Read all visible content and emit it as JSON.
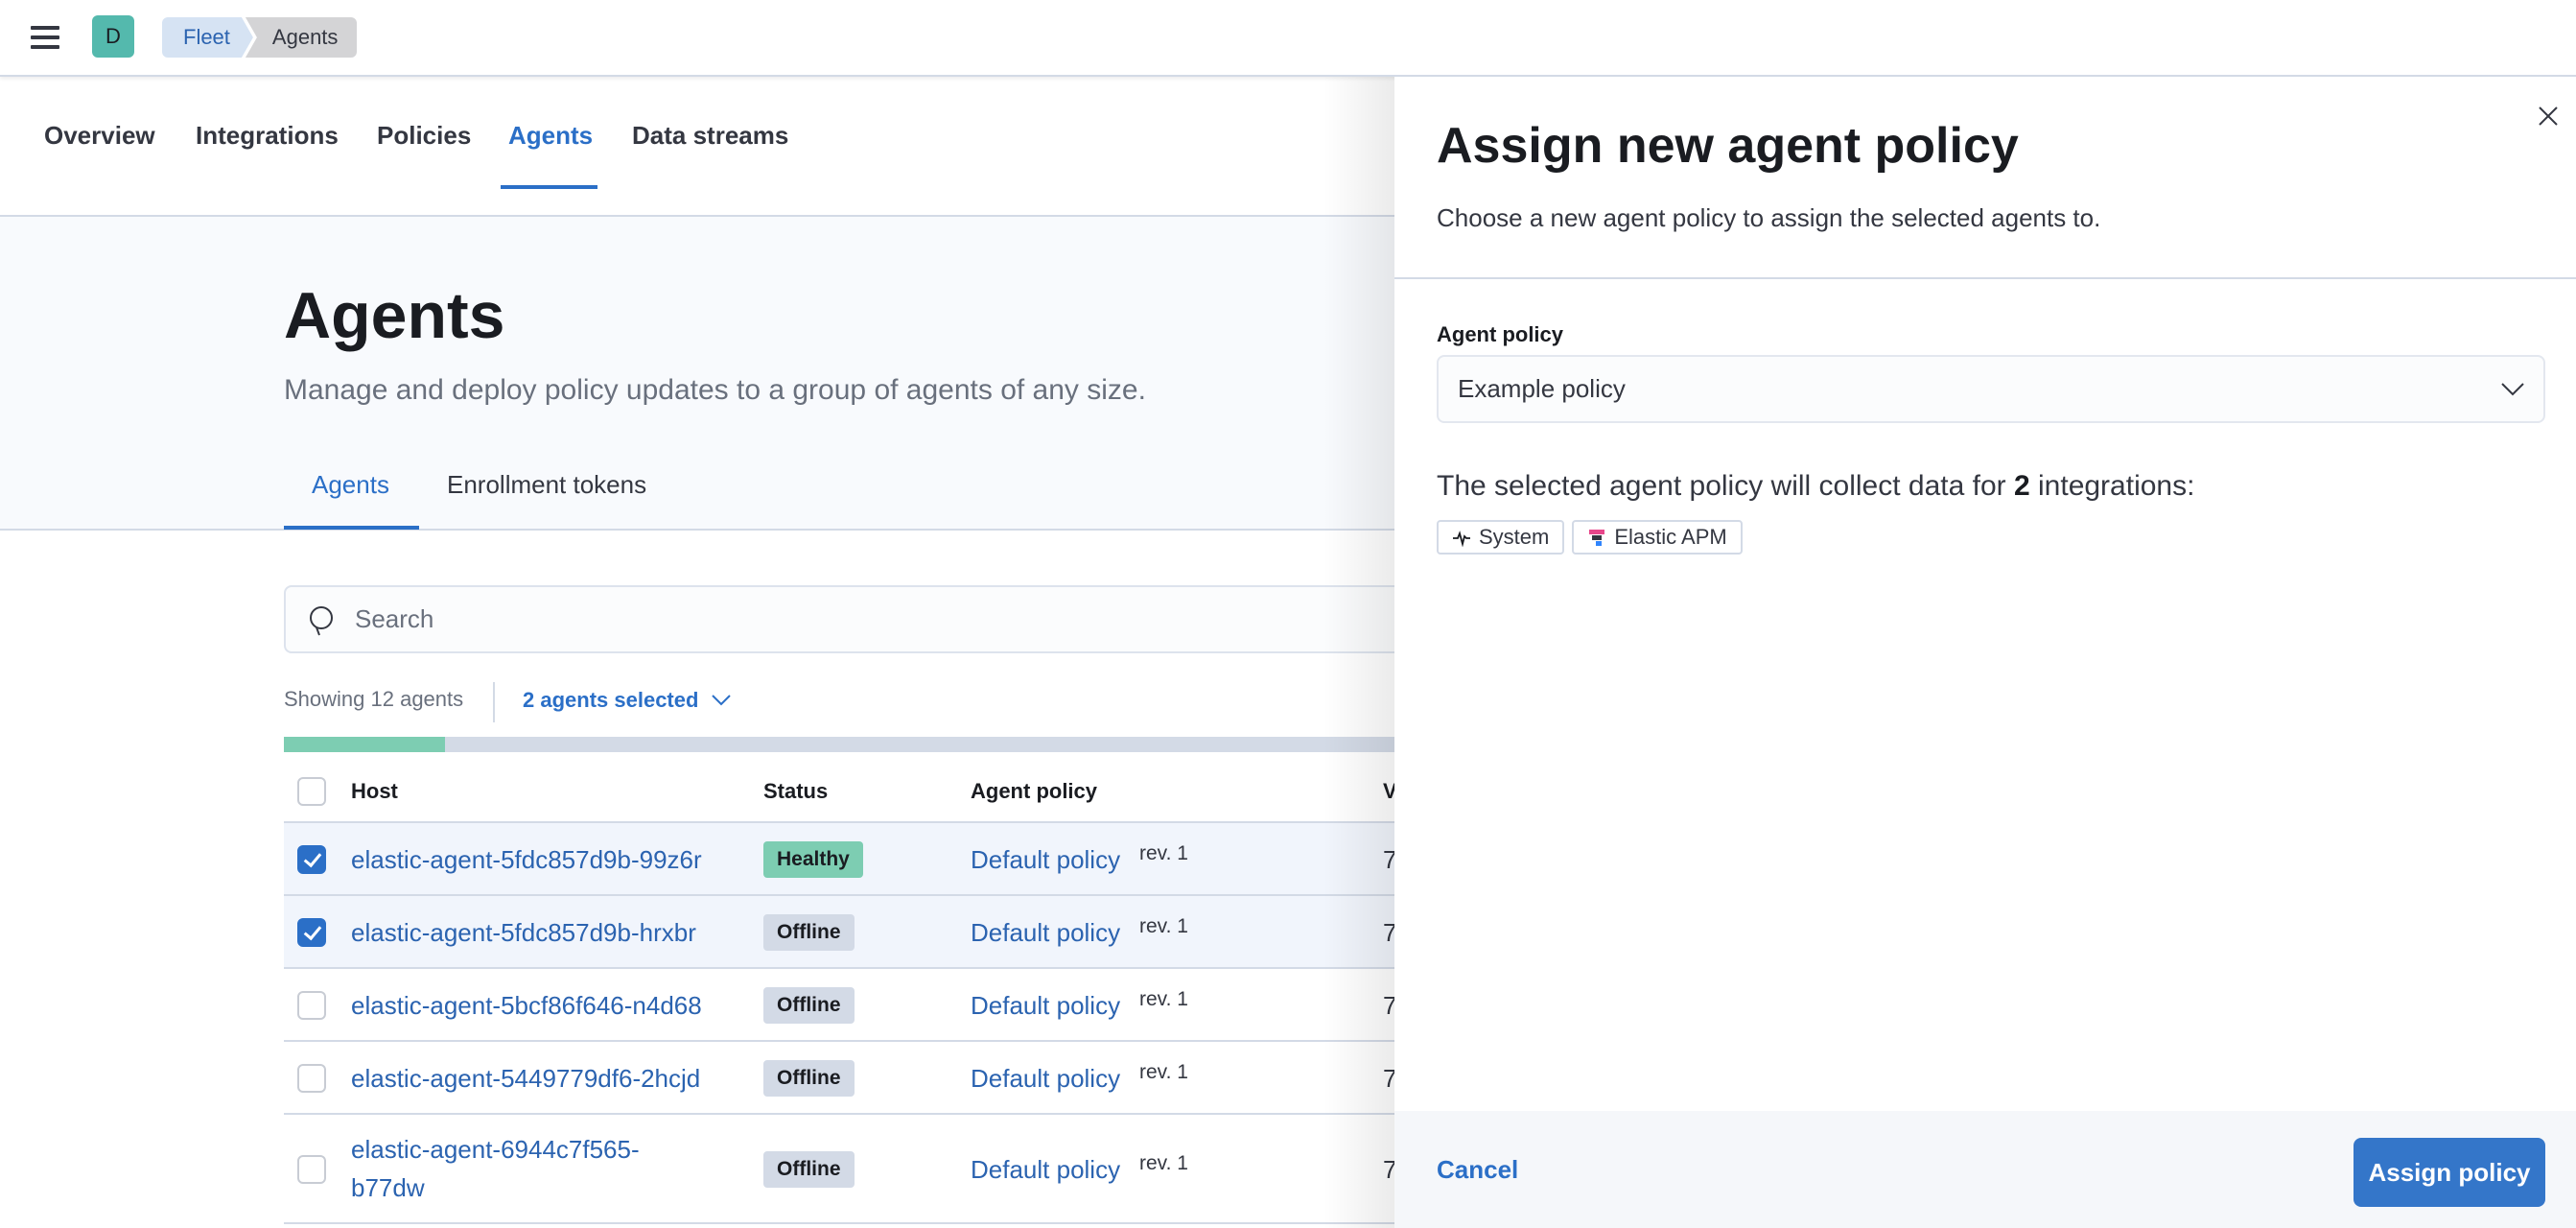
{
  "header": {
    "avatar_initial": "D",
    "breadcrumbs": [
      {
        "label": "Fleet"
      },
      {
        "label": "Agents"
      }
    ]
  },
  "nav": {
    "tabs": [
      {
        "label": "Overview"
      },
      {
        "label": "Integrations"
      },
      {
        "label": "Policies"
      },
      {
        "label": "Agents",
        "active": true
      },
      {
        "label": "Data streams"
      }
    ]
  },
  "page": {
    "title": "Agents",
    "description": "Manage and deploy policy updates to a group of agents of any size.",
    "tabs": [
      {
        "label": "Agents",
        "active": true
      },
      {
        "label": "Enrollment tokens"
      }
    ]
  },
  "search": {
    "placeholder": "Search",
    "value": ""
  },
  "summary": {
    "showing": "Showing 12 agents",
    "selected": "2 agents selected",
    "health_fraction_healthy": 0.12
  },
  "table": {
    "columns": [
      "Host",
      "Status",
      "Agent policy",
      "V"
    ],
    "rows": [
      {
        "host": "elastic-agent-5fdc857d9b-99z6r",
        "status": "Healthy",
        "policy": "Default policy",
        "rev": "rev. 1",
        "version": "7",
        "checked": true
      },
      {
        "host": "elastic-agent-5fdc857d9b-hrxbr",
        "status": "Offline",
        "policy": "Default policy",
        "rev": "rev. 1",
        "version": "7",
        "checked": true
      },
      {
        "host": "elastic-agent-5bcf86f646-n4d68",
        "status": "Offline",
        "policy": "Default policy",
        "rev": "rev. 1",
        "version": "7",
        "checked": false
      },
      {
        "host": "elastic-agent-5449779df6-2hcjd",
        "status": "Offline",
        "policy": "Default policy",
        "rev": "rev. 1",
        "version": "7",
        "checked": false
      },
      {
        "host_line1": "elastic-agent-6944c7f565-",
        "host_line2": "b77dw",
        "host": "elastic-agent-6944c7f565-b77dw",
        "status": "Offline",
        "policy": "Default policy",
        "rev": "rev. 1",
        "version": "7",
        "checked": false
      }
    ]
  },
  "flyout": {
    "title": "Assign new agent policy",
    "description": "Choose a new agent policy to assign the selected agents to.",
    "field_label": "Agent policy",
    "selected_policy": "Example policy",
    "collect_prefix": "The selected agent policy will collect data for ",
    "collect_count": "2",
    "collect_suffix": " integrations:",
    "integrations": [
      {
        "label": "System",
        "icon": "heartbeat-icon"
      },
      {
        "label": "Elastic APM",
        "icon": "apm-icon"
      }
    ],
    "cancel_label": "Cancel",
    "submit_label": "Assign policy"
  },
  "colors": {
    "accent": "#2b6fc7",
    "healthy": "#7dcdb2",
    "offline": "#d3dae6",
    "primary_button": "#3476c9"
  }
}
